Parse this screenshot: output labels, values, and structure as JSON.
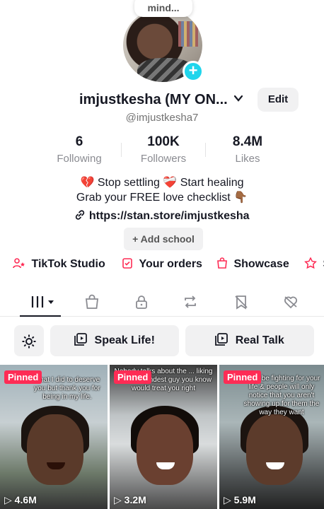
{
  "profile": {
    "note": "mind...",
    "username": "imjustkesha (MY ON...",
    "edit_label": "Edit",
    "handle": "@imjustkesha7",
    "add_school_label": "+ Add school"
  },
  "stats": [
    {
      "value": "6",
      "label": "Following"
    },
    {
      "value": "100K",
      "label": "Followers"
    },
    {
      "value": "8.4M",
      "label": "Likes"
    }
  ],
  "bio": {
    "line1": "💔 Stop settling ❤️‍🩹 Start healing",
    "line2": "Grab your FREE love checklist 👇🏾",
    "link": "https://stan.store/imjustkesha"
  },
  "quick_links": [
    {
      "label": "TikTok Studio",
      "icon": "person-star-icon"
    },
    {
      "label": "Your orders",
      "icon": "clipboard-check-icon"
    },
    {
      "label": "Showcase",
      "icon": "shopping-bag-icon"
    },
    {
      "label": "S",
      "icon": "star-icon"
    }
  ],
  "tabs": [
    {
      "icon": "grid-icon",
      "active": true
    },
    {
      "icon": "shopping-bag-icon",
      "active": false
    },
    {
      "icon": "lock-icon",
      "active": false
    },
    {
      "icon": "repost-icon",
      "active": false
    },
    {
      "icon": "bookmark-off-icon",
      "active": false
    },
    {
      "icon": "heart-off-icon",
      "active": false
    }
  ],
  "playlists": [
    {
      "label": "Speak Life!",
      "icon": "playlist-icon"
    },
    {
      "label": "Real Talk",
      "icon": "playlist-icon"
    }
  ],
  "videos": [
    {
      "pinned_label": "Pinned",
      "caption": "what I did to deserve you but thank you for being in my life.",
      "views": "4.6M"
    },
    {
      "pinned_label": "Pinned",
      "caption": "Nobody talks about the ... liking back the kindest guy you know would treat you right",
      "views": "3.2M"
    },
    {
      "pinned_label": "Pinned",
      "caption": "...ally be fighting for your life & people will only notice that you aren't showing up for them the way they want",
      "views": "5.9M"
    }
  ],
  "colors": {
    "accent": "#fe2c55",
    "badge": "#20d5ec",
    "button_bg": "#f1f1f2"
  }
}
